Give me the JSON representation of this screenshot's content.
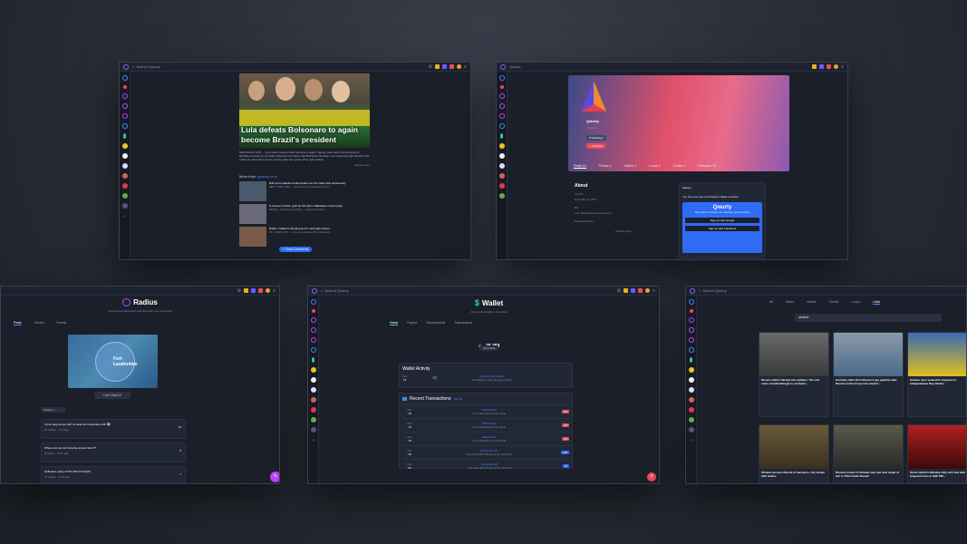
{
  "colors": {
    "accent": "#7a6cff",
    "blue": "#2e6cf6",
    "bg": "#1b1f2a"
  },
  "rail_icons": [
    "home-icon",
    "link-icon",
    "chat-icon",
    "planet-icon",
    "radius-icon",
    "clock-icon",
    "dollar-icon",
    "helmet-icon",
    "umbrella-icon",
    "avatar-icon",
    "avatar-icon",
    "avatar-icon",
    "avatar-icon",
    "avatar-icon",
    "chevron-down-icon"
  ],
  "news": {
    "search_placeholder": "Search Qwurty",
    "headline": "Lula defeats Bolsonaro to again become Brazil's president",
    "body": "SAO PAULO (AP) — Luiz Inácio Lula da Silva has done it again. Twenty years after first winning the Brazilian presidency, the leftist defeated incumbent Jair Bolsonaro Sunday in an extremely tight election that marks an about-face for the country after four years of far-right politics.",
    "source": "apnews.com",
    "more_from_label": "More from",
    "more_from_source": "apnews.com",
    "items": [
      {
        "title": "9/11 terror attacks condemnation as US marks 21st anniversary",
        "desc": "NEW YORK (AP) — Americans remembered 9/11..."
      },
      {
        "title": "S. Korea in shock, grief as 153 die in Halloween crowd surge",
        "desc": "SEOUL, South Korea (AP) — Grief and shock..."
      },
      {
        "title": "Police: 2 killed in shooting at St. Louis high school",
        "desc": "ST. LOUIS (AP) — A former student who returned..."
      }
    ],
    "view_comments": "+ View Comments"
  },
  "profile": {
    "search_placeholder": "Qwurty",
    "name": "Qwurty",
    "handle": "@qwurty",
    "message_btn": "✉ Message",
    "unfollow_btn": "✓ Unfollow",
    "tabs": [
      "Posts 14",
      "Photos 4",
      "Videos 3",
      "Loops 6",
      "Circles 4",
      "Followers 25"
    ],
    "about_title": "About",
    "about_joined": "Joined",
    "about_date": "November 6, 2017",
    "about_bio_label": "Bio",
    "about_bio": "The official account for Qwurty.",
    "featured": "Featured Users",
    "nothing": "Nothing here",
    "post_author": "Qwurty",
    "post_text": "You can now sign up through multiple services",
    "signin_brand": "Qwurty",
    "signin_tagline": "The place to share and discover great content",
    "google_btn": "Sign up with Google",
    "facebook_btn": "Sign up with Facebook"
  },
  "radius": {
    "title": "Radius",
    "subtitle": "Anonymous discussion and chat with your local area",
    "tabs": [
      "Posts",
      "Circles",
      "Events"
    ],
    "map_label": "Fort Lauderdale",
    "live_chat": "Live Chat 12",
    "sort": "Newest",
    "posts": [
      {
        "title": "Come play soccer with us down at Oceanside park! ⚽",
        "meta": "27 replies · 1 hr ago",
        "votes": "12"
      },
      {
        "title": "Where can we rent bicycles around here??",
        "meta": "6 replies · 2 hrs ago",
        "votes": "9"
      },
      {
        "title": "Halloween party at The Wharf tonight!!",
        "meta": "21 replies · 3 hrs ago",
        "votes": "7"
      }
    ]
  },
  "wallet": {
    "search_placeholder": "Search Qwurty",
    "title": "Wallet",
    "subtitle": "All your financials in one place",
    "tabs": [
      "Home",
      "Payout",
      "Subscriptions",
      "Transactions"
    ],
    "balance": "29,359",
    "get_coins": "Get Coins",
    "activity_title": "Wallet Activity",
    "activity_date_month": "Nov",
    "activity_date_day": "19",
    "activity_event": "Payment Verification",
    "activity_desc": "You added a new payment option.",
    "recent_title": "Recent Transactions",
    "see_all": "See All",
    "transactions": [
      {
        "month": "Nov",
        "day": "19",
        "type": "Subscription",
        "desc": "You subscribed to the circle",
        "badge": "-10"
      },
      {
        "month": "Nov",
        "day": "19",
        "type": "Subscription",
        "desc": "You subscribed to the circle",
        "badge": "-10"
      },
      {
        "month": "Nov",
        "day": "19",
        "type": "Subscription",
        "desc": "You subscribed to the circle",
        "badge": "-10"
      },
      {
        "month": "Nov",
        "day": "19",
        "type": "Received Gift",
        "desc": "You were gifted 20 gems for your post",
        "badge": "+20"
      },
      {
        "month": "Nov",
        "day": "03",
        "type": "Received Gift",
        "desc": "You were gifted 5 gems for your post",
        "badge": "+5"
      }
    ]
  },
  "search": {
    "search_placeholder": "Search Qwurty",
    "tabs": [
      "All",
      "Users",
      "Videos",
      "Circles",
      "Loops",
      "Links"
    ],
    "query": "ukraine",
    "results": [
      {
        "title": "Russia retains Ukraine live updates: The U.N. votes overwhelmingly to condemn..."
      },
      {
        "title": "Germany halts Nord Stream 2 gas pipeline after Russia sends troops into eastern..."
      },
      {
        "title": "Ukraine sees 'powerful' response to Independence Day attacks"
      },
      {
        "title": "Ukraine accuses Russia of massacre, city strewn with bodies"
      },
      {
        "title": "Russian troops in Ukraine may test next target of war is 'USA inside Russia'"
      },
      {
        "title": "Stock market's Monday rally can't last with tech a long-term loss in S&P 500..."
      }
    ]
  }
}
